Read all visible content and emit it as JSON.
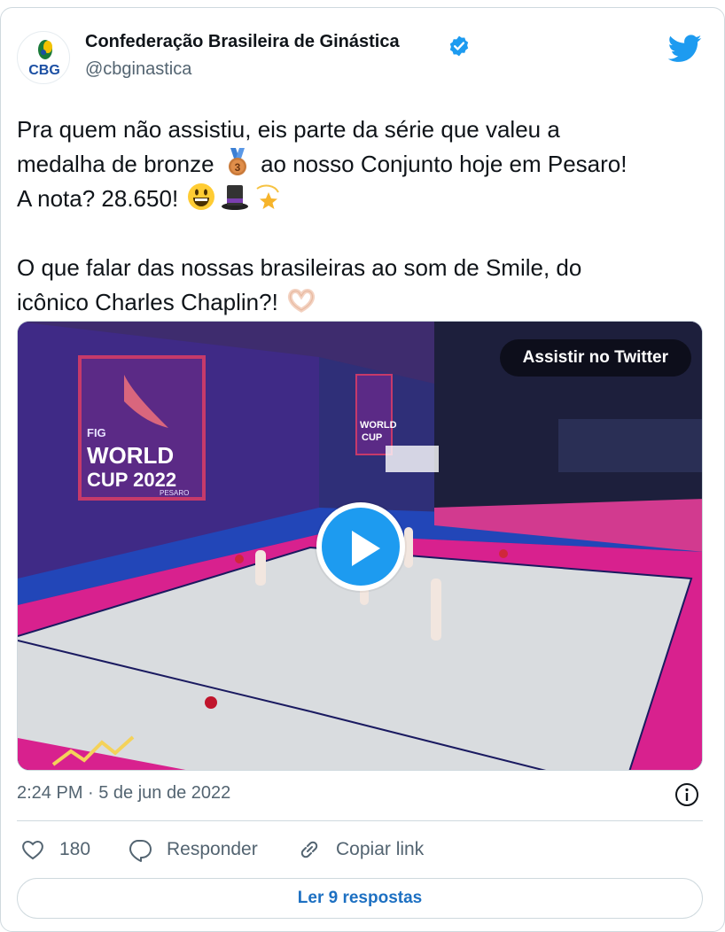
{
  "author": {
    "name": "Confederação Brasileira de Ginástica",
    "handle": "@cbginastica",
    "avatar_text": "CBG",
    "verified": true
  },
  "tweet": {
    "line1": "Pra quem não assistiu, eis parte da série que valeu a",
    "line2_before": "medalha de bronze",
    "line2_after": "ao nosso Conjunto hoje em Pesaro!",
    "line3": "A nota? 28.650!",
    "line4": "O que falar das nossas brasileiras ao som de Smile, do",
    "line5": "icônico Charles Chaplin?!"
  },
  "media": {
    "watch_label": "Assistir no Twitter",
    "banner_line1": "FIG",
    "banner_line2": "WORLD",
    "banner_line3": "CUP 2022",
    "banner_line4": "PESARO",
    "side_banner_line1": "WORLD",
    "side_banner_line2": "CUP"
  },
  "timestamp": "2:24 PM · 5 de jun de 2022",
  "actions": {
    "likes": "180",
    "reply_label": "Responder",
    "copy_label": "Copiar link"
  },
  "read_replies_label": "Ler 9 respostas",
  "colors": {
    "accent": "#1d9bf0",
    "link": "#1d70c2",
    "secondary_text": "#536471",
    "border": "#cfd9de"
  },
  "icons": [
    "twitter-bird-icon",
    "verified-badge-icon",
    "medal-emoji",
    "grinning-emoji",
    "top-hat-emoji",
    "dizzy-emoji",
    "heart-hands-emoji",
    "play-icon",
    "info-icon",
    "heart-icon",
    "reply-icon",
    "link-icon"
  ]
}
